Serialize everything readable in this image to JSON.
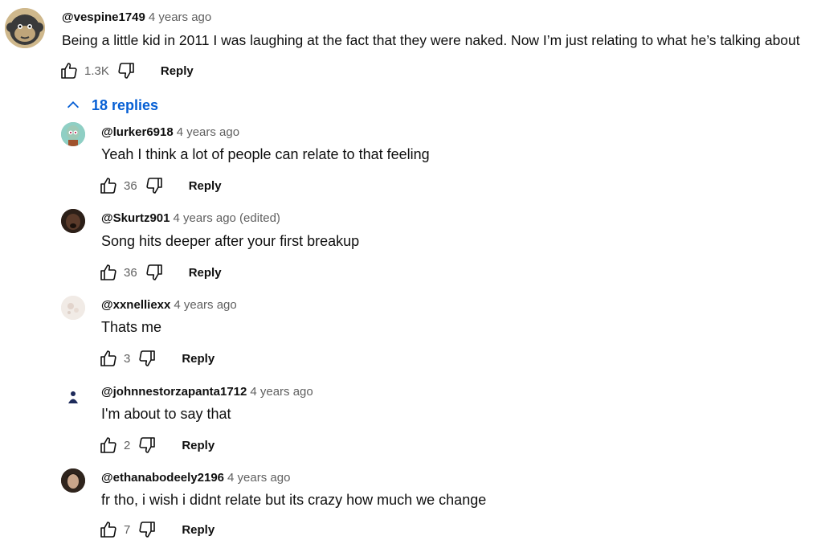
{
  "top_comment": {
    "author": "@vespine1749",
    "time": "4 years ago",
    "text": "Being a little kid in 2011 I was laughing at the fact that they were naked. Now I’m just relating to what he’s talking about",
    "likes": "1.3K",
    "reply_label": "Reply",
    "avatar_icon": "monkey-avatar"
  },
  "replies_toggle": {
    "label": "18 replies",
    "icon": "chevron-up-icon",
    "color": "#065fd4"
  },
  "replies": [
    {
      "author": "@lurker6918",
      "time": "4 years ago",
      "text": "Yeah I think a lot of people can relate to that feeling",
      "likes": "36",
      "reply_label": "Reply"
    },
    {
      "author": "@Skurtz901",
      "time": "4 years ago (edited)",
      "text": "Song hits deeper after your first breakup",
      "likes": "36",
      "reply_label": "Reply"
    },
    {
      "author": "@xxnelliexx",
      "time": "4 years ago",
      "text": "Thats me",
      "likes": "3",
      "reply_label": "Reply"
    },
    {
      "author": "@johnnestorzapanta1712",
      "time": "4 years ago",
      "text": "I'm about to say that",
      "likes": "2",
      "reply_label": "Reply"
    },
    {
      "author": "@ethanabodeely2196",
      "time": "4 years ago",
      "text": "fr tho, i wish i didnt relate but its crazy how much we change",
      "likes": "7",
      "reply_label": "Reply"
    }
  ]
}
